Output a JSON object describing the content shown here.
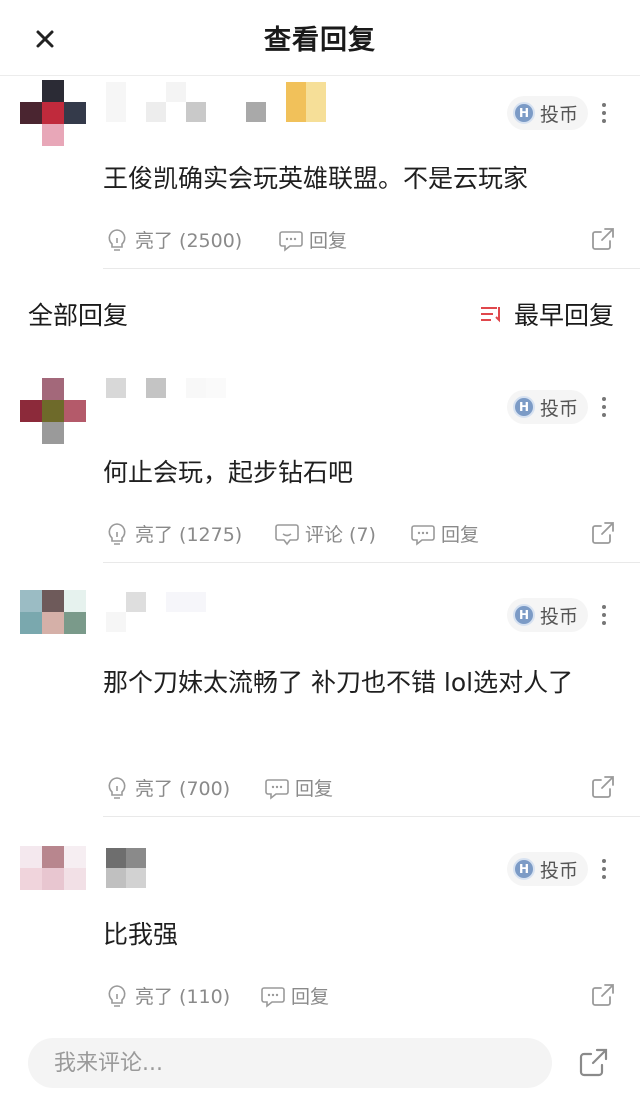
{
  "header": {
    "title": "查看回复"
  },
  "main_comment": {
    "text": "王俊凯确实会玩英雄联盟。不是云玩家",
    "coin_label": "投币",
    "like_label": "亮了 (2500)",
    "reply_label": "回复"
  },
  "replies_section": {
    "title": "全部回复",
    "sort_label": "最早回复"
  },
  "replies": [
    {
      "text": "何止会玩，起步钻石吧",
      "coin_label": "投币",
      "like_label": "亮了 (1275)",
      "comment_label": "评论 (7)",
      "reply_label": "回复"
    },
    {
      "text": "那个刀妹太流畅了 补刀也不错 lol选对人了",
      "coin_label": "投币",
      "like_label": "亮了 (700)",
      "reply_label": "回复"
    },
    {
      "text": "比我强",
      "coin_label": "投币",
      "like_label": "亮了 (110)",
      "reply_label": "回复"
    }
  ],
  "composer": {
    "placeholder": "我来评论..."
  },
  "icons": {
    "close": "close-icon",
    "coin": "coin-icon",
    "more": "more-icon",
    "like": "lightbulb-icon",
    "reply": "chat-bubble-icon",
    "comment": "comment-icon",
    "share": "share-icon",
    "sort": "sort-icon"
  },
  "colors": {
    "text_primary": "#1f1f1f",
    "text_secondary": "#8a8a8a",
    "sort_icon": "#e0474c",
    "coin": "#7c9bc6",
    "divider": "#e9e9e9"
  }
}
